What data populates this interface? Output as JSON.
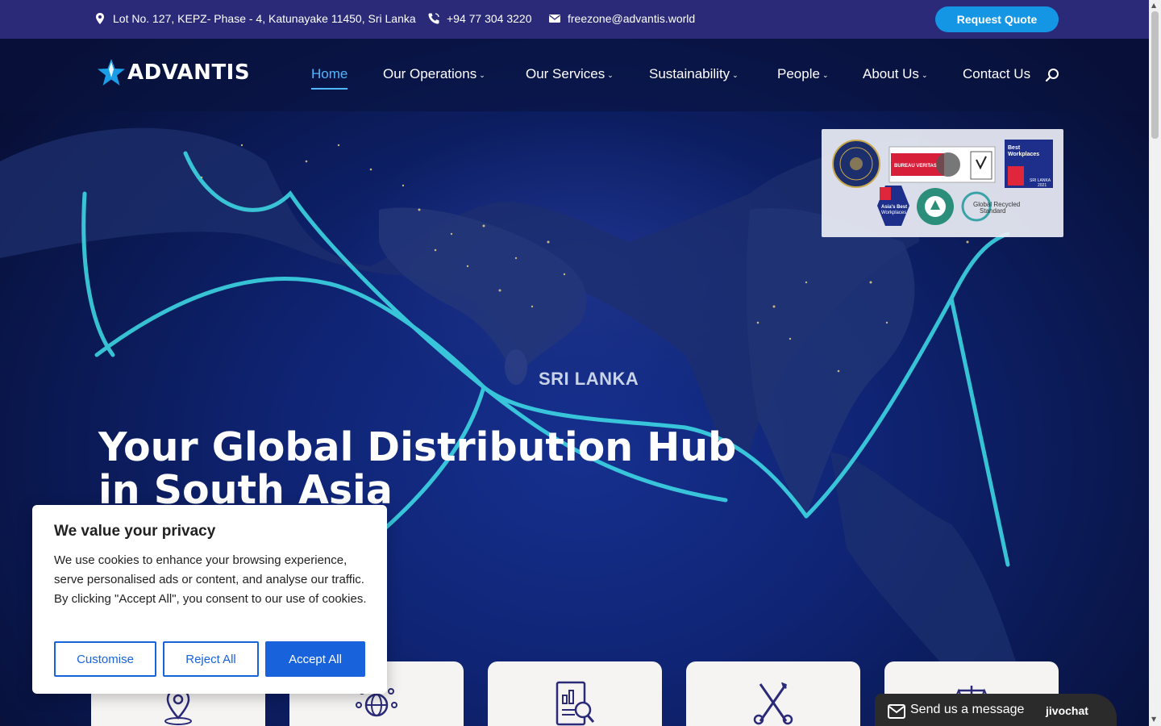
{
  "topbar": {
    "address": "Lot No. 127, KEPZ- Phase - 4, Katunayake 11450, Sri Lanka",
    "phone": "+94 77 304 3220",
    "email": "freezone@advantis.world",
    "quote_label": "Request Quote"
  },
  "nav": {
    "logo_text": "ADVANTIS",
    "items": [
      {
        "label": "Home",
        "active": true
      },
      {
        "label": "Our Operations",
        "dropdown": true
      },
      {
        "label": "Our Services",
        "dropdown": true
      },
      {
        "label": "Sustainability",
        "dropdown": true
      },
      {
        "label": "People",
        "dropdown": true
      },
      {
        "label": "About Us",
        "dropdown": true
      },
      {
        "label": "Contact Us"
      }
    ]
  },
  "badges": {
    "bureau_veritas": "BUREAU VERITAS",
    "best_workplaces": "Best Workplaces",
    "asia_best": "Asia's Best Workplaces",
    "year": "2021",
    "recycled": "RECYCLED 100",
    "grs": "Global Recycled Standard"
  },
  "hero": {
    "map_label": "SRI LANKA",
    "title_line1": "Your Global Distribution Hub",
    "title_line2": "in South Asia"
  },
  "cards": [
    {
      "icon": "location-pin-icon"
    },
    {
      "icon": "globe-network-icon"
    },
    {
      "icon": "report-analysis-icon"
    },
    {
      "icon": "tools-icon"
    },
    {
      "icon": "scales-icon"
    }
  ],
  "cookie": {
    "title": "We value your privacy",
    "text": "We use cookies to enhance your browsing experience, serve personalised ads or content, and analyse our traffic. By clicking \"Accept All\", you consent to our use of cookies.",
    "customise": "Customise",
    "reject": "Reject All",
    "accept": "Accept All"
  },
  "chat": {
    "label": "Send us a message",
    "brand": "jivochat"
  },
  "colors": {
    "topbar": "#2a2a78",
    "accent": "#1596e4",
    "cookie_primary": "#1863dc",
    "route": "#3fe0ea"
  }
}
